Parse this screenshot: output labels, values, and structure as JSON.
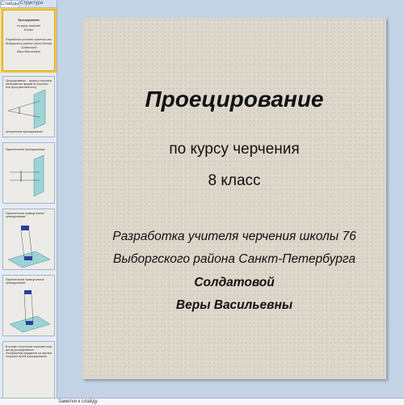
{
  "tabs": [
    {
      "label": "Слайды",
      "active": true
    },
    {
      "label": "Структура",
      "active": false
    }
  ],
  "thumbnails": [
    {
      "lines": [
        "Проецирование",
        "по курсу черчения",
        "8 класс",
        "Разработка учителя черчения школы 76",
        "Выборгского района Санкт-Петербурга",
        "Солдатовой",
        "Веры Васильевны"
      ]
    },
    {
      "lines": [
        "Проецирование – процесс получения",
        "изображения предмета (плоского",
        "или пространственного)"
      ],
      "caption": "центральное проецирование"
    },
    {
      "lines": [
        "Параллельное проецирование"
      ]
    },
    {
      "lines": [
        "Параллельное прямоугольное",
        "проецирование"
      ]
    },
    {
      "lines": [
        "Параллельное прямоугольное",
        "проецирование"
      ]
    },
    {
      "lines": [
        "В основе построения чертежей лежит",
        "метод проецирования.",
        "Изображения предметов на чертеже",
        "получают путём проецирования."
      ]
    }
  ],
  "notes": {
    "placeholder": "Заметки к слайду"
  },
  "slide": {
    "title": "Проецирование",
    "subtitle_1": "по курсу черчения",
    "subtitle_2": "8 класс",
    "author_1": "Разработка учителя черчения школы 76",
    "author_2": "Выборгского района Санкт-Петербурга",
    "author_3": "Солдатовой",
    "author_4": "Веры Васильевны"
  },
  "colors": {
    "window_bg": "#c3d3e6",
    "slide_bg": "#ddd6cb",
    "selected_outline": "#f2c94c",
    "accent_plane": "#9bd3d6",
    "accent_blue": "#2c3f9e"
  }
}
